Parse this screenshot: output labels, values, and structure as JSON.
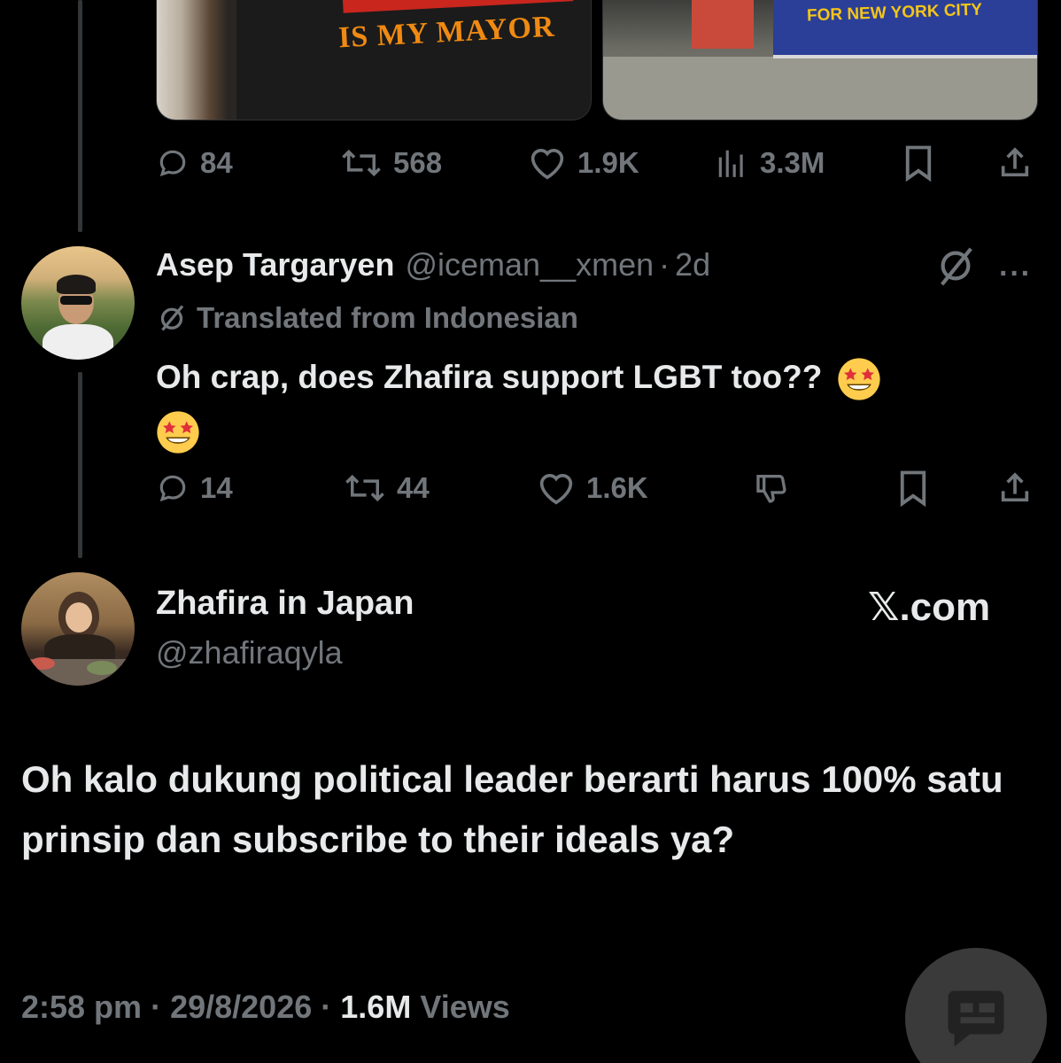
{
  "top_tweet": {
    "media": [
      {
        "caption": "IS MY MAYOR"
      },
      {
        "caption": "FOR NEW YORK CITY"
      }
    ],
    "actions": {
      "replies": "84",
      "reposts": "568",
      "likes": "1.9K",
      "views": "3.3M"
    }
  },
  "reply": {
    "display_name": "Asep Targaryen",
    "handle": "@iceman__xmen",
    "separator": "·",
    "time": "2d",
    "translated_label": "Translated from Indonesian",
    "text": "Oh crap, does Zhafira support LGBT too??",
    "more": "···",
    "actions": {
      "replies": "14",
      "reposts": "44",
      "likes": "1.6K"
    }
  },
  "main_tweet": {
    "display_name": "Zhafira in Japan",
    "handle": "@zhafiraqyla",
    "watermark": "𝕏.com",
    "text": "Oh kalo dukung political leader berarti harus 100% satu prinsip dan subscribe to their ideals ya?",
    "time": "2:58 pm",
    "date": "29/8/2026",
    "views_count": "1.6M",
    "views_label": "Views",
    "separator": "·"
  },
  "colors": {
    "background": "#000000",
    "text_primary": "#e7e9ea",
    "text_secondary": "#71767b",
    "thread_line": "#333639"
  },
  "icons": [
    "reply-icon",
    "repost-icon",
    "like-icon",
    "views-icon",
    "bookmark-icon",
    "share-icon",
    "translate-icon",
    "grok-icon",
    "dislike-icon",
    "more-icon",
    "chat-fab-icon"
  ]
}
